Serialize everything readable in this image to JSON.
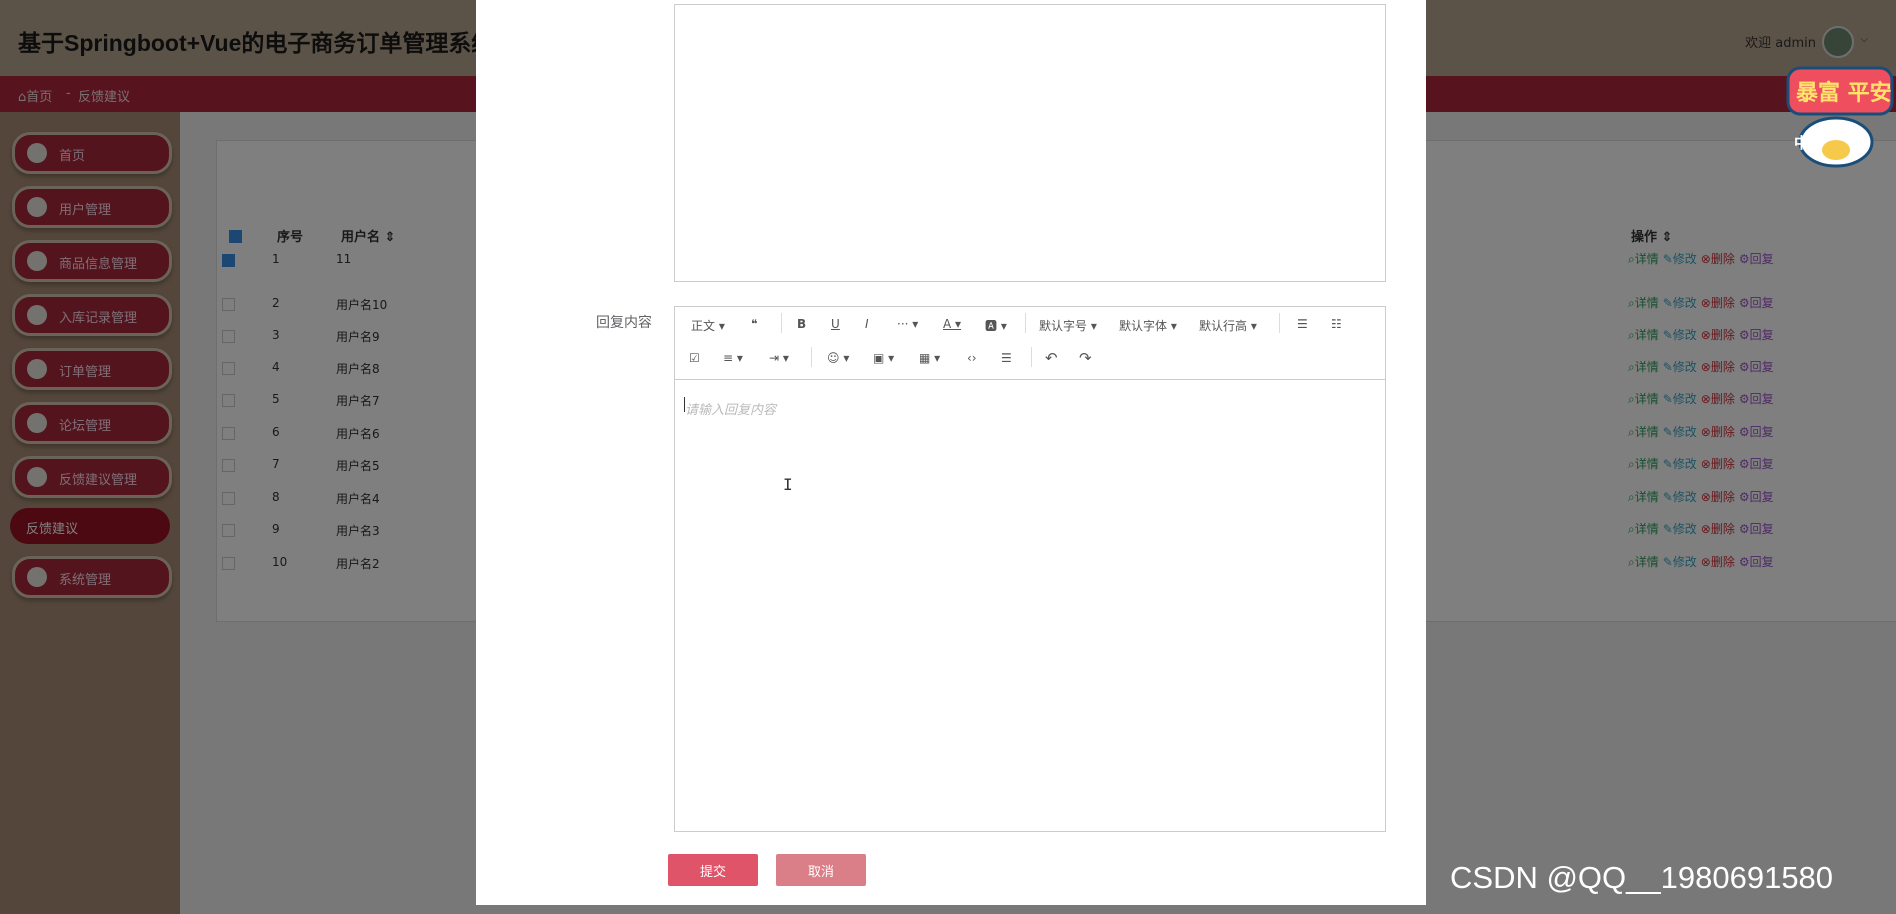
{
  "header": {
    "title": "基于Springboot+Vue的电子商务订单管理系统设",
    "welcome": "欢迎 admin",
    "caret": "⌵"
  },
  "breadcrumb": {
    "home": "⌂首页",
    "sep": "-",
    "current": "反馈建议"
  },
  "sidebar": {
    "items": [
      {
        "label": "首页",
        "icon": "home-icon"
      },
      {
        "label": "用户管理",
        "icon": "user-icon"
      },
      {
        "label": "商品信息管理",
        "icon": "goods-icon"
      },
      {
        "label": "入库记录管理",
        "icon": "storage-icon"
      },
      {
        "label": "订单管理",
        "icon": "order-icon"
      },
      {
        "label": "论坛管理",
        "icon": "forum-icon"
      },
      {
        "label": "反馈建议管理",
        "icon": "feedback-icon"
      },
      {
        "label": "系统管理",
        "icon": "system-icon"
      }
    ],
    "active_sub": "反馈建议"
  },
  "table": {
    "col_index": "序号",
    "col_user": "用户名 ⇕",
    "col_ops": "操作 ⇕",
    "rows": [
      {
        "index": "1",
        "name": "11",
        "checked": true
      },
      {
        "index": "2",
        "name": "用户名10"
      },
      {
        "index": "3",
        "name": "用户名9"
      },
      {
        "index": "4",
        "name": "用户名8"
      },
      {
        "index": "5",
        "name": "用户名7"
      },
      {
        "index": "6",
        "name": "用户名6"
      },
      {
        "index": "7",
        "name": "用户名5"
      },
      {
        "index": "8",
        "name": "用户名4"
      },
      {
        "index": "9",
        "name": "用户名3"
      },
      {
        "index": "10",
        "name": "用户名2"
      }
    ],
    "actions": {
      "detail": "⌕详情",
      "edit": "✎修改",
      "delete": "⊗删除",
      "reply": "⚙回复"
    }
  },
  "deco": {
    "text": "暴富 平安",
    "small": "中"
  },
  "modal": {
    "reply_label": "回复内容",
    "placeholder": "请输入回复内容",
    "toolbar": {
      "paragraph": "正文 ▾",
      "quote": "❝",
      "bold": "B",
      "underline": "U",
      "italic": "I",
      "more": "··· ▾",
      "font_color": "A ▾",
      "bg_color": "🅰 ▾",
      "font_size": "默认字号 ▾",
      "font_family": "默认字体 ▾",
      "line_height": "默认行高 ▾",
      "bullet_list": "☰",
      "numbered_list": "☷",
      "todo": "☑",
      "align": "≡ ▾",
      "indent": "⇥ ▾",
      "emoji": "☺ ▾",
      "image": "▣ ▾",
      "table": "▦ ▾",
      "code": "‹›",
      "divider": "☰",
      "undo": "↶",
      "redo": "↷"
    },
    "submit": "提交",
    "cancel": "取消",
    "ibeam": "I"
  },
  "watermark": "CSDN @QQ__1980691580"
}
